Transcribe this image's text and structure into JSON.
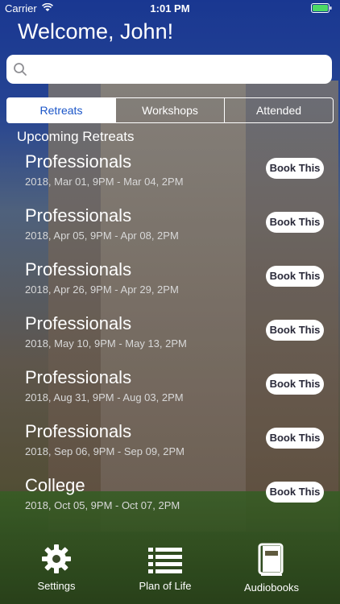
{
  "status": {
    "carrier": "Carrier",
    "time": "1:01 PM"
  },
  "welcome": "Welcome, John!",
  "search": {
    "placeholder": ""
  },
  "tabs": [
    {
      "label": "Retreats",
      "active": true
    },
    {
      "label": "Workshops",
      "active": false
    },
    {
      "label": "Attended",
      "active": false
    }
  ],
  "section_title": "Upcoming Retreats",
  "retreats": [
    {
      "title": "Professionals",
      "dates": "2018, Mar 01, 9PM - Mar 04, 2PM",
      "button": "Book This"
    },
    {
      "title": "Professionals",
      "dates": "2018, Apr 05, 9PM - Apr 08, 2PM",
      "button": "Book This"
    },
    {
      "title": "Professionals",
      "dates": "2018, Apr 26, 9PM - Apr 29, 2PM",
      "button": "Book This"
    },
    {
      "title": "Professionals",
      "dates": "2018, May 10, 9PM - May 13, 2PM",
      "button": "Book This"
    },
    {
      "title": "Professionals",
      "dates": "2018, Aug 31, 9PM - Aug 03, 2PM",
      "button": "Book This"
    },
    {
      "title": "Professionals",
      "dates": "2018, Sep 06, 9PM - Sep 09, 2PM",
      "button": "Book This"
    },
    {
      "title": "College",
      "dates": "2018, Oct 05, 9PM - Oct 07, 2PM",
      "button": "Book This"
    }
  ],
  "tabbar": {
    "settings": "Settings",
    "plan": "Plan of Life",
    "audiobooks": "Audiobooks"
  },
  "colors": {
    "accent": "#1a55c8",
    "battery": "#4cd964"
  }
}
